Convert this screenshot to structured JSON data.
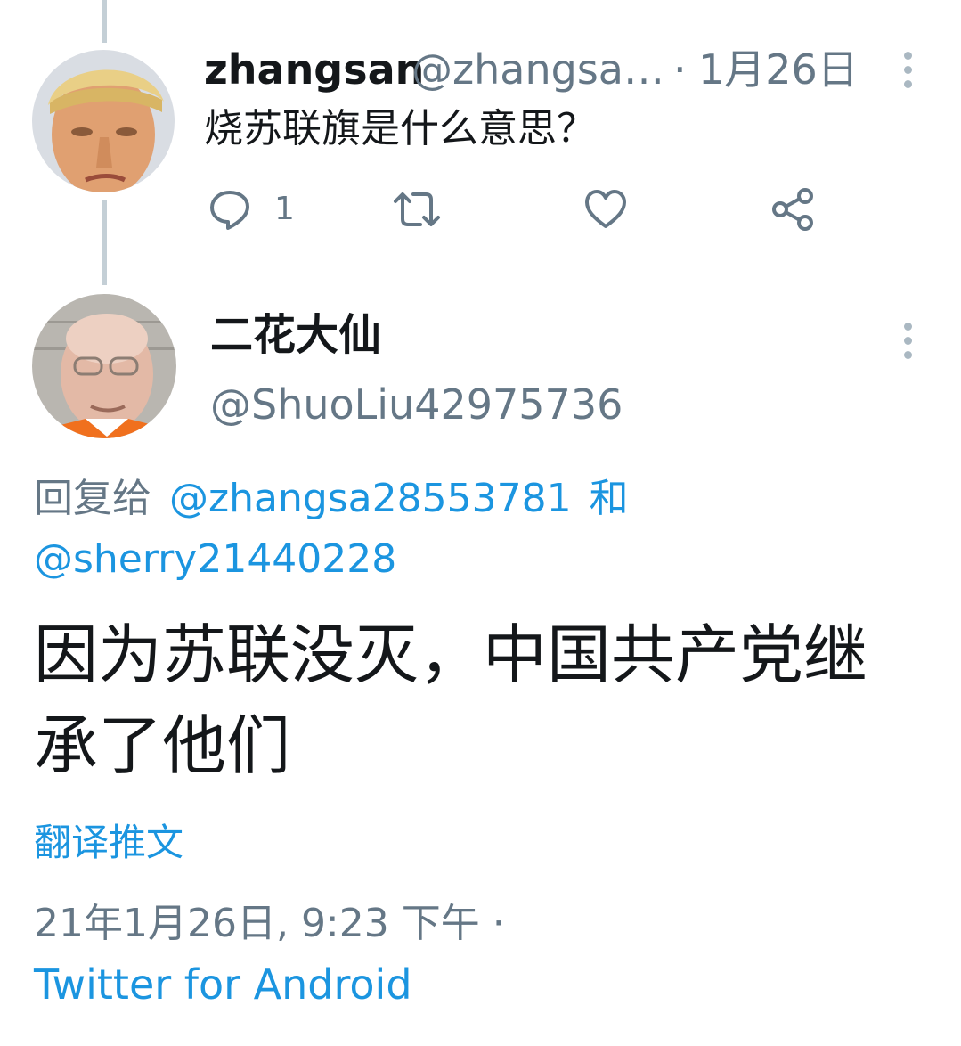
{
  "parent_tweet": {
    "display_name": "zhangsan",
    "handle": "@zhangsa…",
    "separator": "·",
    "date": "1月26日",
    "text": "烧苏联旗是什么意思？",
    "reply_count": "1",
    "icons": {
      "reply": "reply-icon",
      "retweet": "retweet-icon",
      "like": "heart-icon",
      "share": "share-icon",
      "more": "more-vertical-icon"
    }
  },
  "main_tweet": {
    "display_name": "二花大仙",
    "handle": "@ShuoLiu42975736",
    "reply_prefix": "回复给",
    "reply_to_1": "@zhangsa28553781",
    "reply_join": "和",
    "reply_to_2": "@sherry21440228",
    "text_line1": "因为苏联没灭，中国共产党继",
    "text_line2": "承了他们",
    "translate_label": "翻译推文",
    "timestamp": "21年1月26日, 9:23 下午 ·",
    "source": "Twitter for Android"
  },
  "colors": {
    "text": "#14171a",
    "muted": "#657786",
    "link": "#1b95e0",
    "thread_line": "#c4cfd6",
    "background": "#ffffff"
  }
}
